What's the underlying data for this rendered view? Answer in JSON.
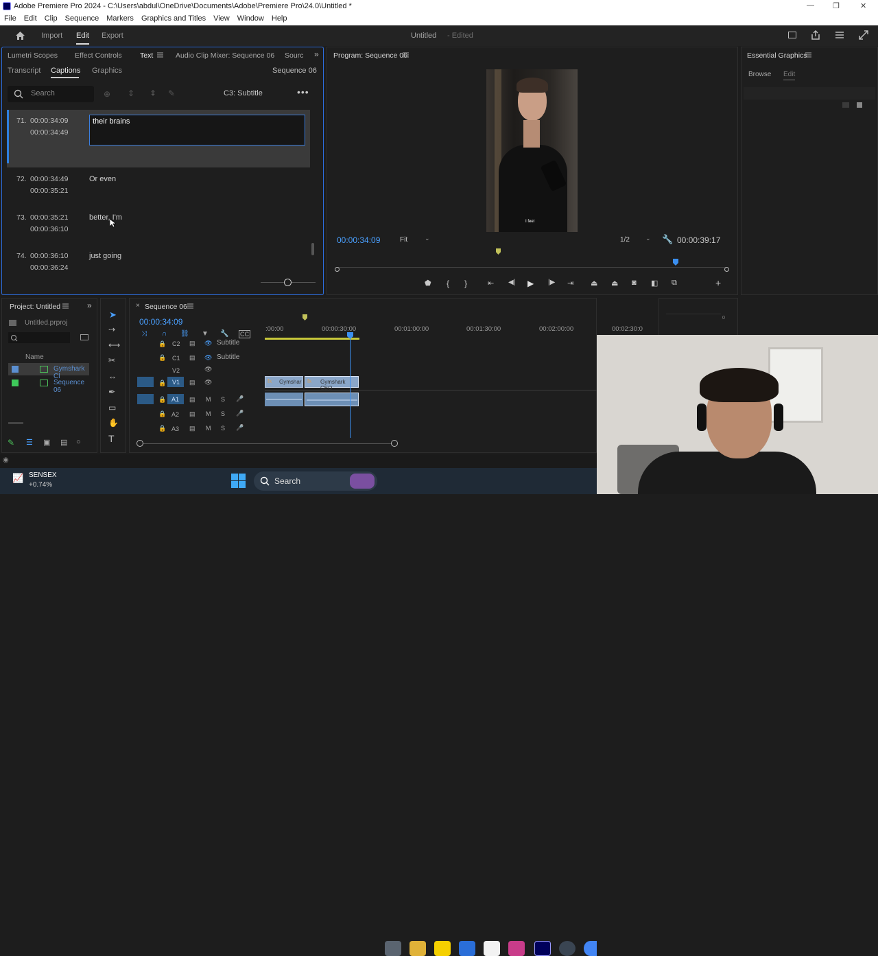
{
  "window": {
    "title": "Adobe Premiere Pro 2024 - C:\\Users\\abdul\\OneDrive\\Documents\\Adobe\\Premiere Pro\\24.0\\Untitled *",
    "controls": [
      "—",
      "❐",
      "✕"
    ]
  },
  "menu": [
    "File",
    "Edit",
    "Clip",
    "Sequence",
    "Markers",
    "Graphics and Titles",
    "View",
    "Window",
    "Help"
  ],
  "workspace": {
    "tabs": [
      "Import",
      "Edit",
      "Export"
    ],
    "active": "Edit",
    "project_title": "Untitled",
    "project_status": "- Edited"
  },
  "text_panel": {
    "panel_tabs": [
      "Lumetri Scopes",
      "Effect Controls",
      "Text",
      "Audio Clip Mixer: Sequence 06",
      "Sourc"
    ],
    "sub_tabs": [
      "Transcript",
      "Captions",
      "Graphics"
    ],
    "active_sub_tab": "Captions",
    "sequence_name": "Sequence 06",
    "search_placeholder": "Search",
    "track_label": "C3: Subtitle",
    "captions": [
      {
        "num": "71.",
        "in": "00:00:34:09",
        "out": "00:00:34:49",
        "text": "their brains"
      },
      {
        "num": "72.",
        "in": "00:00:34:49",
        "out": "00:00:35:21",
        "text": "Or even"
      },
      {
        "num": "73.",
        "in": "00:00:35:21",
        "out": "00:00:36:10",
        "text": "better, I'm"
      },
      {
        "num": "74.",
        "in": "00:00:36:10",
        "out": "00:00:36:24",
        "text": "just going"
      }
    ]
  },
  "program": {
    "title": "Program: Sequence 06",
    "timecode": "00:00:34:09",
    "fit": "Fit",
    "resolution": "1/2",
    "duration": "00:00:39:17",
    "caption_overlay": "I feel"
  },
  "essential_graphics": {
    "title": "Essential Graphics",
    "tabs": [
      "Browse",
      "Edit"
    ]
  },
  "project_panel": {
    "title": "Project: Untitled",
    "file": "Untitled.prproj",
    "column": "Name",
    "items": [
      "Gymshark Cl",
      "Sequence 06"
    ],
    "item_colors": [
      "#5b8fd0",
      "#3ec95a"
    ]
  },
  "timeline": {
    "sequence": "Sequence 06",
    "timecode": "00:00:34:09",
    "ruler": [
      ":00:00",
      "00:00:30:00",
      "00:01:00:00",
      "00:01:30:00",
      "00:02:00:00",
      "00:02:30:0"
    ],
    "caption_tracks": [
      {
        "name": "C2",
        "label": "Subtitle"
      },
      {
        "name": "C1",
        "label": "Subtitle"
      }
    ],
    "video_tracks": [
      "V2",
      "V1"
    ],
    "audio_tracks": [
      "A1",
      "A2",
      "A3"
    ],
    "clips": [
      "Gymshar",
      "Gymshark CEO"
    ],
    "track_buttons": {
      "mute": "M",
      "solo": "S"
    }
  },
  "taskbar": {
    "ticker_name": "SENSEX",
    "ticker_value": "+0.74%",
    "search": "Search"
  }
}
